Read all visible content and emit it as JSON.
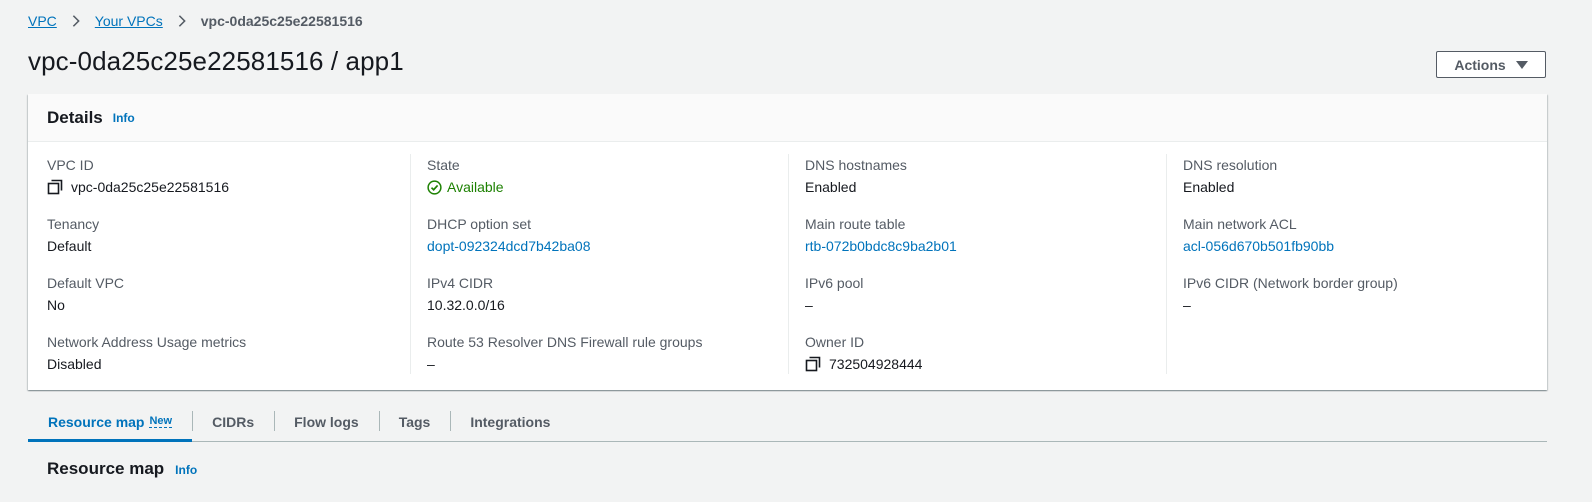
{
  "breadcrumb": {
    "items": [
      "VPC",
      "Your VPCs"
    ],
    "current": "vpc-0da25c25e22581516"
  },
  "page": {
    "title": "vpc-0da25c25e22581516 / app1",
    "actions_label": "Actions"
  },
  "details": {
    "title": "Details",
    "info_label": "Info",
    "vpc_id": {
      "label": "VPC ID",
      "value": "vpc-0da25c25e22581516"
    },
    "state": {
      "label": "State",
      "value": "Available",
      "color": "#1d8102"
    },
    "dns_hostnames": {
      "label": "DNS hostnames",
      "value": "Enabled"
    },
    "dns_resolution": {
      "label": "DNS resolution",
      "value": "Enabled"
    },
    "tenancy": {
      "label": "Tenancy",
      "value": "Default"
    },
    "dhcp_option_set": {
      "label": "DHCP option set",
      "value": "dopt-092324dcd7b42ba08"
    },
    "main_route_table": {
      "label": "Main route table",
      "value": "rtb-072b0bdc8c9ba2b01"
    },
    "main_network_acl": {
      "label": "Main network ACL",
      "value": "acl-056d670b501fb90bb"
    },
    "default_vpc": {
      "label": "Default VPC",
      "value": "No"
    },
    "ipv4_cidr": {
      "label": "IPv4 CIDR",
      "value": "10.32.0.0/16"
    },
    "ipv6_pool": {
      "label": "IPv6 pool",
      "value": "–"
    },
    "ipv6_cidr": {
      "label": "IPv6 CIDR (Network border group)",
      "value": "–"
    },
    "network_address_usage": {
      "label": "Network Address Usage metrics",
      "value": "Disabled"
    },
    "route53_firewall": {
      "label": "Route 53 Resolver DNS Firewall rule groups",
      "value": "–"
    },
    "owner_id": {
      "label": "Owner ID",
      "value": "732504928444"
    }
  },
  "tabs": [
    {
      "label": "Resource map",
      "badge": "New"
    },
    {
      "label": "CIDRs"
    },
    {
      "label": "Flow logs"
    },
    {
      "label": "Tags"
    },
    {
      "label": "Integrations"
    }
  ],
  "resource_map": {
    "title": "Resource map",
    "info_label": "Info"
  },
  "colors": {
    "link": "#0073bb",
    "success": "#1d8102",
    "background": "#f2f3f3"
  },
  "icons": [
    "chevron-right-icon",
    "copy-icon",
    "status-success-icon",
    "caret-down-icon"
  ]
}
